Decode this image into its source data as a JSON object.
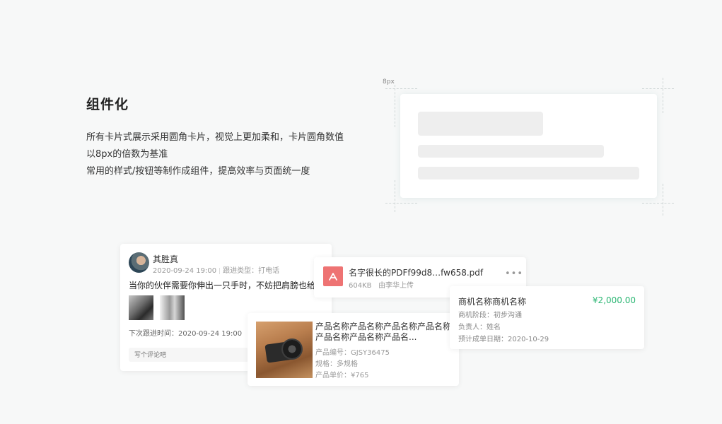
{
  "intro": {
    "title": "组件化",
    "lines": [
      "所有卡片式展示采用圆角卡片，视觉上更加柔和，卡片圆角数值",
      "以8px的倍数为基准",
      "常用的样式/按钮等制作成组件，提高效率与页面统一度"
    ]
  },
  "spec": {
    "radius_label": "8px"
  },
  "followup": {
    "name": "其胜真",
    "date": "2020-09-24 19:00",
    "type": "跟进类型：打电话",
    "content": "当你的伙伴需要你伸出一只手时，不妨把肩膀也给他",
    "next": "下次跟进时间：2020-09-24 19:00",
    "comment_placeholder": "写个评论吧"
  },
  "pdf": {
    "icon": "pdf-icon",
    "filename": "名字很长的PDFf99d8…fw658.pdf",
    "size": "604KB",
    "uploader": "由李华上传",
    "more": "•••"
  },
  "opportunity": {
    "name": "商机名称商机名称",
    "amount": "¥2,000.00",
    "stage": "商机阶段：初步沟通",
    "owner": "负责人：姓名",
    "deal_date": "预计成单日期：2020-10-29",
    "amount_color": "#2bb673"
  },
  "product": {
    "name": "产品名称产品名称产品名称产品名称产品名称产品名称产品名...",
    "code": "产品编号：GJSY36475",
    "spec": "规格：多规格",
    "price": "产品单价：¥765"
  }
}
